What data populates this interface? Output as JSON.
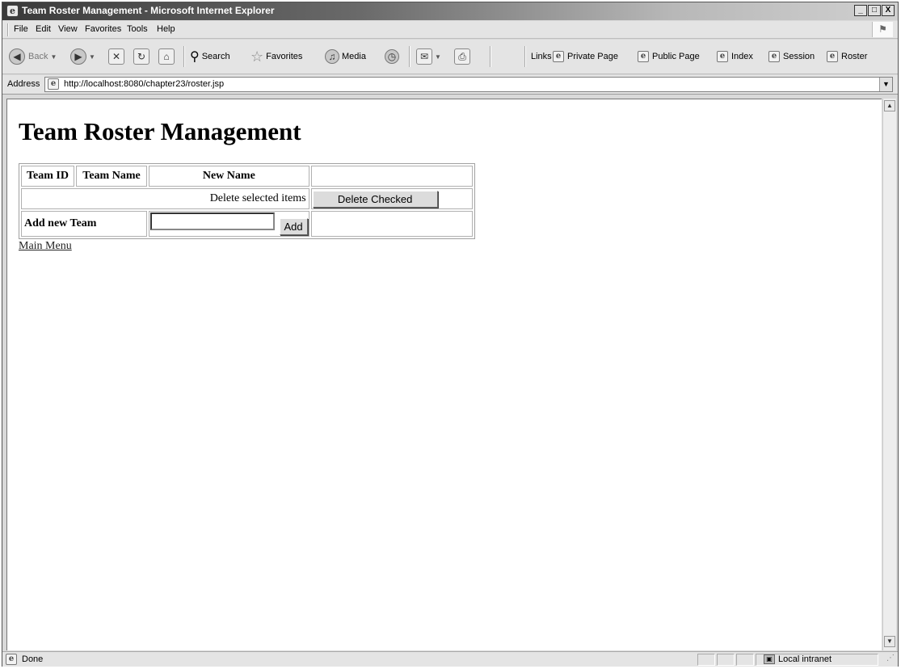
{
  "window": {
    "title": "Team Roster Management - Microsoft Internet Explorer",
    "controls": {
      "minimize": "_",
      "maximize": "□",
      "close": "X"
    }
  },
  "menu": [
    "File",
    "Edit",
    "View",
    "Favorites",
    "Tools",
    "Help"
  ],
  "toolbar": {
    "back_label": "Back",
    "search_label": "Search",
    "favorites_label": "Favorites",
    "media_label": "Media",
    "links_label": "Links",
    "links": [
      "Private Page",
      "Public Page",
      "Index",
      "Session",
      "Roster"
    ]
  },
  "address": {
    "label": "Address",
    "url": "http://localhost:8080/chapter23/roster.jsp"
  },
  "page": {
    "title": "Team Roster Management",
    "table": {
      "headers": [
        "Team ID",
        "Team Name",
        "New Name"
      ],
      "delete_label": "Delete selected items",
      "delete_button": "Delete Checked",
      "add_label": "Add new Team",
      "add_value": "",
      "add_button": "Add"
    },
    "main_menu_link": "Main Menu"
  },
  "status": {
    "text": "Done",
    "zone": "Local intranet"
  }
}
